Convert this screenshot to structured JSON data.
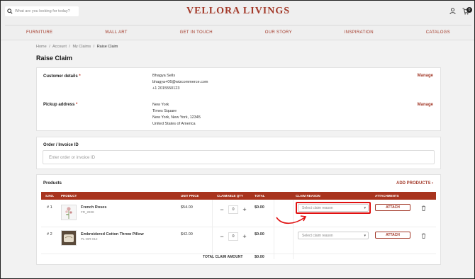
{
  "header": {
    "search_placeholder": "What are you looking for today?",
    "logo": "VELLORA  LIVINGS",
    "cart_count": "0",
    "nav": [
      "FURNITURE",
      "WALL ART",
      "GET IN TOUCH",
      "OUR STORY",
      "INSPIRATION",
      "CATALOGS"
    ]
  },
  "breadcrumb": [
    "Home",
    "/",
    "Account",
    "/",
    "My Claims",
    "/",
    "Raise Claim"
  ],
  "page_title": "Raise Claim",
  "customer": {
    "label": "Customer details",
    "required": "*",
    "lines": [
      "Bhagya Sells",
      "bhagya+06@wizcommerce.com",
      "+1 2015550123"
    ],
    "manage": "Manage"
  },
  "pickup": {
    "label": "Pickup address",
    "required": "*",
    "lines": [
      "New York",
      "Times Square",
      "New York, New York, 12345",
      "United States of America"
    ],
    "manage": "Manage"
  },
  "order": {
    "label": "Order / Invoice ID",
    "placeholder": "Enter order or invoice ID"
  },
  "products": {
    "label": "Products",
    "add": "ADD PRODUCTS ›",
    "columns": [
      "S.NO.",
      "PRODUCT",
      "UNIT PRICE",
      "CLAIMABLE QTY",
      "TOTAL",
      "CLAIM REASON",
      "ATTACHMENTS"
    ],
    "rows": [
      {
        "sno": "# 1",
        "name": "French Roses",
        "sku": "FR_2838",
        "price": "$54.00",
        "qty": "0",
        "total": "$0.00",
        "reason": "Select claim reason",
        "attach": "ATTACH"
      },
      {
        "sno": "# 2",
        "name": "Embroidered Cotton Throw Pillow",
        "sku": "PL-WR-012",
        "price": "$42.00",
        "qty": "0",
        "total": "$0.00",
        "reason": "Select claim reason",
        "attach": "ATTACH"
      }
    ],
    "total_label": "TOTAL CLAIM AMOUNT",
    "total_value": "$0.00"
  },
  "colors": {
    "brand": "#a33a2a",
    "header_row": "#a8341e",
    "highlight": "#e01010"
  }
}
